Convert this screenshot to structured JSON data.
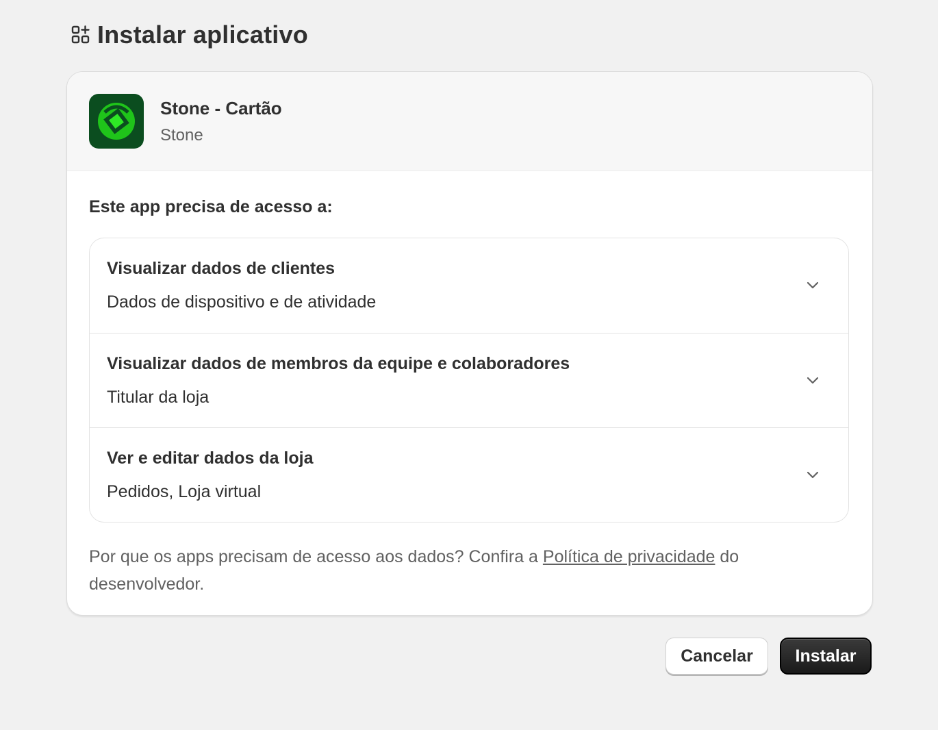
{
  "header": {
    "icon": "apps-add-icon",
    "title": "Instalar aplicativo"
  },
  "app": {
    "name": "Stone - Cartão",
    "developer": "Stone",
    "logo_colors": {
      "background": "#0b4d1f",
      "mark": "#21d11a"
    }
  },
  "access": {
    "heading": "Este app precisa de acesso a:",
    "permissions": [
      {
        "title": "Visualizar dados de clientes",
        "description": "Dados de dispositivo e de atividade"
      },
      {
        "title": "Visualizar dados de membros da equipe e colaboradores",
        "description": "Titular da loja"
      },
      {
        "title": "Ver e editar dados da loja",
        "description": "Pedidos, Loja virtual"
      }
    ]
  },
  "privacy": {
    "prefix": "Por que os apps precisam de acesso aos dados? Confira a ",
    "link": "Política de privacidade",
    "suffix": " do desenvolvedor."
  },
  "actions": {
    "cancel": "Cancelar",
    "install": "Instalar"
  }
}
